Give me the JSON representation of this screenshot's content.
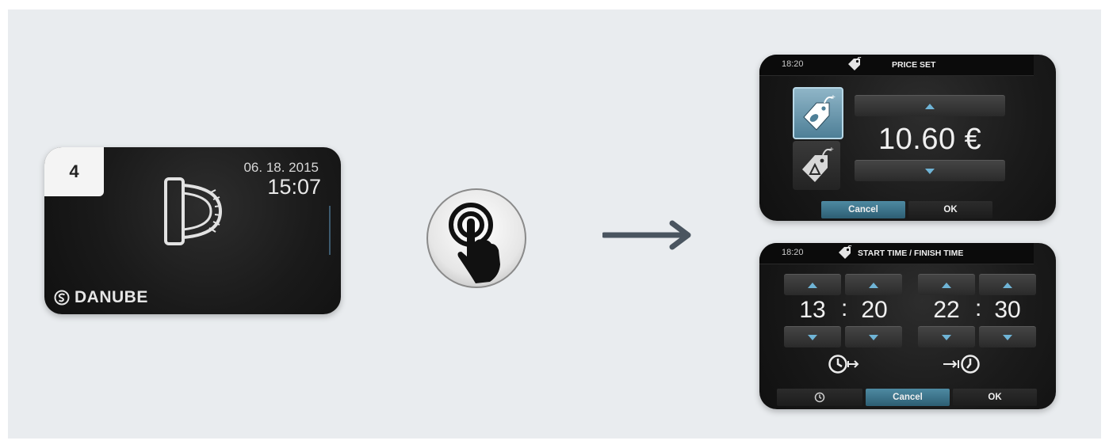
{
  "idle_screen": {
    "badge": "4",
    "date": "06. 18. 2015",
    "time": "15:07",
    "brand": "DANUBE",
    "icon": "coin-slot-icon"
  },
  "touch_icon": "tap-touch-icon",
  "arrow_icon": "right-arrow-icon",
  "price_screen": {
    "clock": "18:20",
    "title": "PRICE SET",
    "price": "10.60 €",
    "cancel": "Cancel",
    "ok": "OK"
  },
  "time_screen": {
    "clock": "18:20",
    "title": "START TIME / FINISH TIME",
    "start_hour": "13",
    "start_min": "20",
    "end_hour": "22",
    "end_min": "30",
    "separator": ":",
    "cancel": "Cancel",
    "ok": "OK"
  },
  "colors": {
    "accent": "#4e8aa2",
    "arrow": "#4a5560",
    "stage_bg": "#e9ecef"
  }
}
